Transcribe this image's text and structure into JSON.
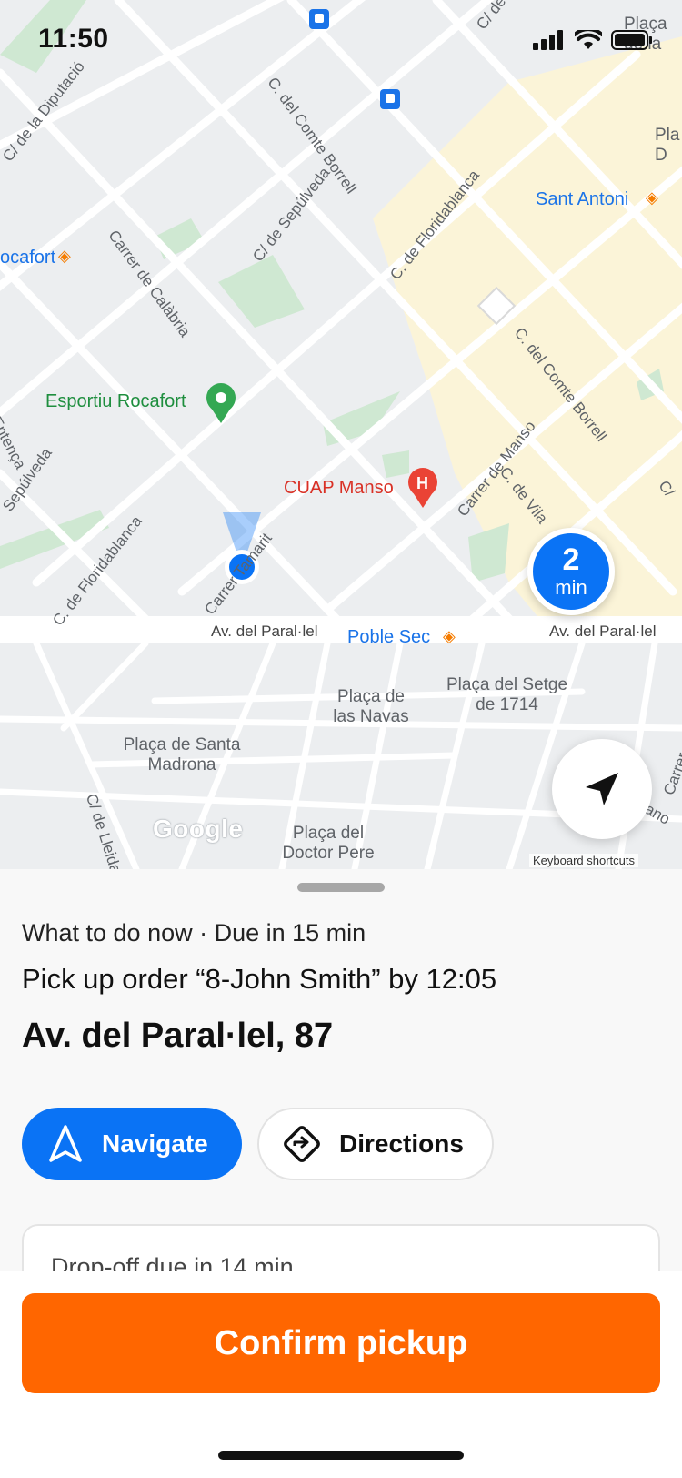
{
  "status_bar": {
    "time": "11:50"
  },
  "map": {
    "streets": [
      "C/ de la Diputació",
      "C. del Comte Borrell",
      "C/ de Sepúlveda",
      "C. de Floridablanca",
      "Carrer de Calàbria",
      "C. del Comte Borrell",
      "Carrer de Manso",
      "C. de Vila",
      "C. de Floridablanca",
      "Carrer Tamarit",
      "Av. del Paral·lel",
      "Av. del Paral·lel",
      "C/ de Lleida",
      "Entença",
      "Sepúlveda",
      "C/ de",
      "C/",
      "Carrer",
      "ano"
    ],
    "pois": {
      "esportiu": "Esportiu Rocafort",
      "cuap": "CUAP Manso",
      "sant_antoni": "Sant Antoni",
      "rocafort": "ocafort",
      "poble_sec": "Poble Sec"
    },
    "plazas": [
      "Plaça de las Navas",
      "Plaça del Setge de 1714",
      "Plaça de Santa Madrona",
      "Plaça del Doctor Pere",
      "Plaça de la",
      "Pla D"
    ],
    "eta": {
      "value": "2",
      "unit": "min"
    },
    "google_logo": "Google",
    "keyboard_shortcuts": "Keyboard shortcuts"
  },
  "task": {
    "due_line": "What to do now · Due in 15 min",
    "order_line": "Pick up order “8-John Smith” by 12:05",
    "address": "Av. del Paral·lel, 87",
    "navigate_label": "Navigate",
    "directions_label": "Directions",
    "next_step": "Drop-off due in 14 min",
    "confirm_label": "Confirm pickup"
  },
  "colors": {
    "accent_blue": "#0a73f5",
    "confirm_orange": "#ff6600"
  }
}
